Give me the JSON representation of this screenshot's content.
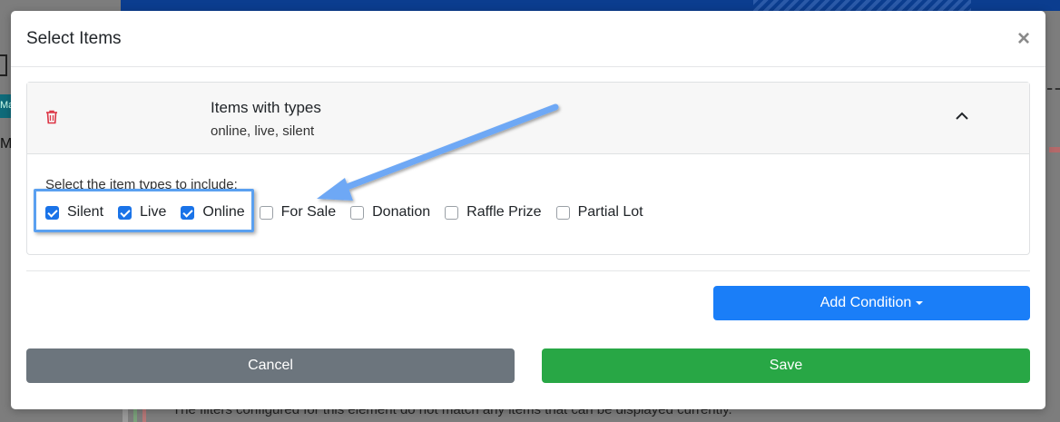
{
  "background": {
    "left_fragment": "Ma",
    "left_fragment2": "ME",
    "bottom_text": "The filters configured for this element do not match any items that can be displayed currently."
  },
  "modal": {
    "title": "Select Items",
    "close_icon": "close-icon"
  },
  "condition": {
    "title": "Items with types",
    "subtitle": "online, live, silent",
    "delete_icon": "trash-icon",
    "collapse_icon": "chevron-up-icon",
    "prompt": "Select the item types to include:",
    "options": [
      {
        "label": "Silent",
        "checked": true
      },
      {
        "label": "Live",
        "checked": true
      },
      {
        "label": "Online",
        "checked": true
      },
      {
        "label": "For Sale",
        "checked": false
      },
      {
        "label": "Donation",
        "checked": false
      },
      {
        "label": "Raffle Prize",
        "checked": false
      },
      {
        "label": "Partial Lot",
        "checked": false
      }
    ]
  },
  "actions": {
    "add_condition": "Add Condition",
    "cancel": "Cancel",
    "save": "Save"
  },
  "colors": {
    "primary": "#1a7ef8",
    "secondary": "#6c757d",
    "success": "#28a745",
    "danger": "#dc3545",
    "annotation": "#5aa0f0"
  }
}
